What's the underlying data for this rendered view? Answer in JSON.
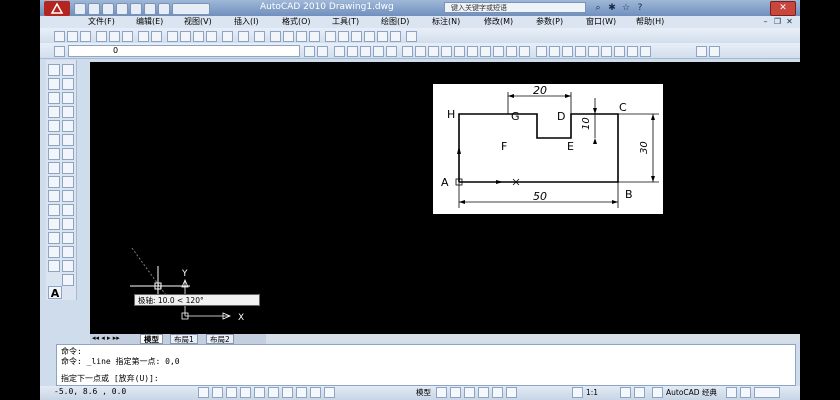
{
  "window": {
    "title": "AutoCAD 2010    Drawing1.dwg",
    "help_search_placeholder": "键入关键字或短语",
    "close_glyph": "✕"
  },
  "menu": [
    "文件(F)",
    "编辑(E)",
    "视图(V)",
    "插入(I)",
    "格式(O)",
    "工具(T)",
    "绘图(D)",
    "标注(N)",
    "修改(M)",
    "参数(P)",
    "窗口(W)",
    "帮助(H)"
  ],
  "layer_toolbar": {
    "current_layer": "0"
  },
  "canvas": {
    "background": "#000000",
    "figure": {
      "points": [
        "H",
        "G",
        "D",
        "C",
        "F",
        "E",
        "A",
        "B"
      ],
      "dimensions": {
        "top_width": "20",
        "depth": "10",
        "height": "30",
        "bottom_width": "50"
      }
    },
    "tooltip": "极轴: 10.0 < 120°",
    "ucs": {
      "x": "X",
      "y": "Y"
    }
  },
  "tabs": [
    "模型",
    "布局1",
    "布局2"
  ],
  "command": {
    "line1": "命令:",
    "line2": "命令: _line 指定第一点: 0,0",
    "line3": "指定下一点或 [放弃(U)]:"
  },
  "status": {
    "coords": "-5.0, 8.6 , 0.0",
    "model": "模型",
    "scale": "1:1",
    "workspace": "AutoCAD 经典"
  }
}
